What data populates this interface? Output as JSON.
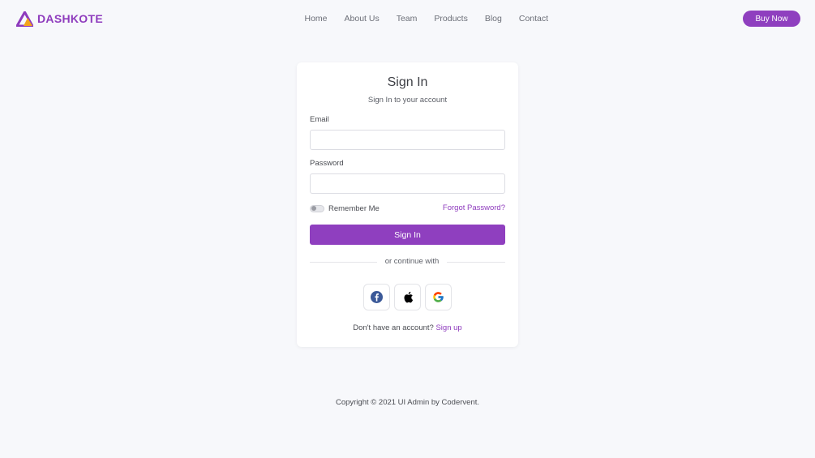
{
  "brand": {
    "name": "DASHKOTE",
    "logo_icon": "triangle-logo-icon"
  },
  "nav": {
    "items": [
      {
        "label": "Home"
      },
      {
        "label": "About Us"
      },
      {
        "label": "Team"
      },
      {
        "label": "Products"
      },
      {
        "label": "Blog"
      },
      {
        "label": "Contact"
      }
    ]
  },
  "header": {
    "buy_label": "Buy Now"
  },
  "signin": {
    "title": "Sign In",
    "subtitle": "Sign In to your account",
    "email_label": "Email",
    "email_value": "",
    "password_label": "Password",
    "password_value": "",
    "remember_label": "Remember Me",
    "remember_checked": false,
    "forgot_label": "Forgot Password?",
    "submit_label": "Sign In",
    "divider_text": "or continue with",
    "social": [
      {
        "icon": "facebook-icon"
      },
      {
        "icon": "apple-icon"
      },
      {
        "icon": "google-icon"
      }
    ],
    "signup_prompt": "Don't have an account?",
    "signup_link": "Sign up"
  },
  "footer": {
    "copyright": "Copyright © 2021 UI Admin by Codervent."
  },
  "colors": {
    "accent": "#8f3fbf",
    "background": "#f7f8fb",
    "card": "#ffffff"
  }
}
